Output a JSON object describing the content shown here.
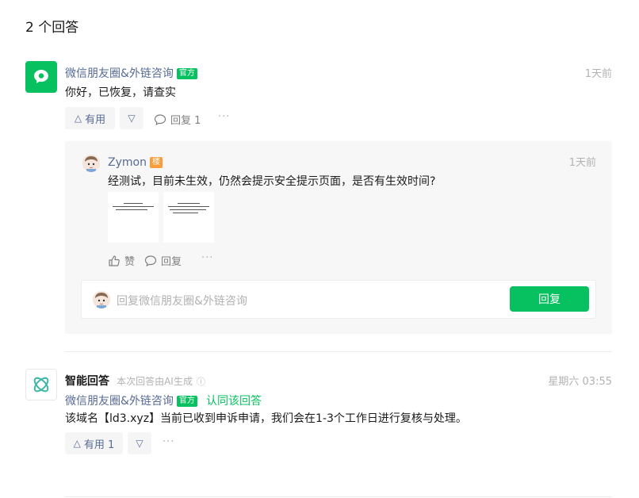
{
  "header": {
    "answer_count": "2 个回答"
  },
  "answer1": {
    "author": "微信朋友圈&外链咨询",
    "badge": "官方",
    "time": "1天前",
    "content": "你好，已恢复，请查实",
    "useful_label": "有用",
    "reply_label": "回复 1",
    "more": "···",
    "colors": {
      "brand_green": "#07c160",
      "link_blue": "#576b95"
    }
  },
  "reply": {
    "author": "Zymon",
    "badge": "楼",
    "time": "1天前",
    "content": "经测试，目前未生效，仍然会提示安全提示页面，是否有生效时间?",
    "like_label": "赞",
    "reply_label": "回复",
    "more": "···",
    "input_placeholder": "回复微信朋友圈&外链咨询",
    "submit_label": "回复"
  },
  "answer2": {
    "title": "智能回答",
    "ai_note": "本次回答由AI生成",
    "info_icon": "ⓘ",
    "time": "星期六 03:55",
    "endorser": "微信朋友圈&外链咨询",
    "badge": "官方",
    "endorse_text": "认同该回答",
    "content": "该域名【ld3.xyz】当前已收到申诉申请，我们会在1-3个工作日进行复核与处理。",
    "useful_label": "有用 1",
    "more": "···"
  }
}
